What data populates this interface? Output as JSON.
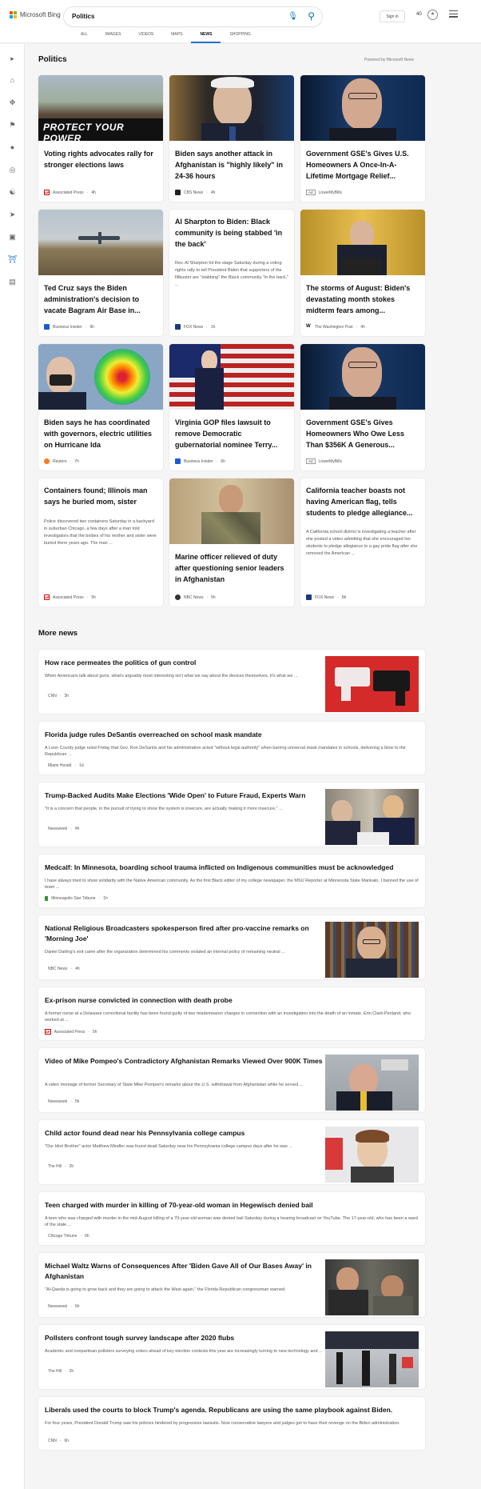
{
  "header": {
    "brand": "Microsoft Bing",
    "query": "Politics",
    "sign_in": "Sign in",
    "rewards": "40"
  },
  "tabs": [
    "ALL",
    "IMAGES",
    "VIDEOS",
    "MAPS",
    "NEWS",
    "SHOPPING"
  ],
  "section": {
    "title": "Politics",
    "powered": "Powered by Microsoft News"
  },
  "cards": [
    {
      "title": "Voting rights advocates rally for stronger elections laws",
      "source": "Associated Press",
      "age": "4h",
      "image_text": "PROTECT YOUR POWER"
    },
    {
      "title": "Biden says another attack in Afghanistan is \"highly likely\" in 24-36 hours",
      "source": "CBS News",
      "age": "4h"
    },
    {
      "title": "Government GSE's Gives U.S. Homeowners A Once-In-A-Lifetime Mortgage Relief...",
      "ad": "Ad",
      "source": "LowerMyBills"
    },
    {
      "title": "Ted Cruz says the Biden administration's decision to vacate Bagram Air Base in...",
      "source": "Business Insider",
      "age": "9h"
    },
    {
      "title": "Al Sharpton to Biden: Black community is being stabbed 'in the back'",
      "snippet": "Rev. Al Sharpton hit the stage Saturday during a voting rights rally to tell President Biden that supporters of the filibuster are \"stabbing\" the Black community \"in the back.\" ...",
      "source": "FOX News",
      "age": "1h"
    },
    {
      "title": "The storms of August: Biden's devastating month stokes midterm fears among...",
      "source": "The Washington Post",
      "age": "4h"
    },
    {
      "title": "Biden says he has coordinated with governors, electric utilities on Hurricane Ida",
      "source": "Reuters",
      "age": "7h"
    },
    {
      "title": "Virginia GOP files lawsuit to remove Democratic gubernatorial nominee Terry...",
      "source": "Business Insider",
      "age": "6h"
    },
    {
      "title": "Government GSE's Gives Homeowners Who Owe Less Than $356K A Generous...",
      "ad": "Ad",
      "source": "LowerMyBills"
    },
    {
      "title": "Containers found; Illinois man says he buried mom, sister",
      "snippet": "Police discovered two containers Saturday in a backyard in suburban Chicago, a few days after a man told investigators that the bodies of his mother and sister were buried there years ago. The man ...",
      "source": "Associated Press",
      "age": "5h"
    },
    {
      "title": "Marine officer relieved of duty after questioning senior leaders in Afghanistan",
      "source": "NBC News",
      "age": "5h"
    },
    {
      "title": "California teacher boasts not having American flag, tells students to pledge allegiance...",
      "snippet": "A California school district is investigating a teacher after she posted a video admitting that she encouraged her students to pledge allegiance to a gay pride flag after she removed the American ...",
      "source": "FOX News",
      "age": "8h"
    }
  ],
  "more_news_title": "More news",
  "more_news": [
    {
      "title": "How race permeates the politics of gun control",
      "snippet": "When Americans talk about guns, what's arguably most interesting isn't what we say about the devices themselves. It's what we ...",
      "source": "CNN",
      "age": "3h"
    },
    {
      "title": "Florida judge rules DeSantis overreached on school mask mandate",
      "snippet": "A Leon County judge ruled Friday that Gov. Ron DeSantis and his administration acted \"without legal authority\" when barring universal mask mandates in schools, delivering a blow to the Republican ...",
      "source": "Miami Herald",
      "age": "1d"
    },
    {
      "title": "Trump-Backed Audits Make Elections 'Wide Open' to Future Fraud, Experts Warn",
      "snippet": "\"It is a concern that people, in the pursuit of trying to show the system is insecure, are actually making it more insecure,\" ...",
      "source": "Newsweek",
      "age": "4h"
    },
    {
      "title": "Medcalf: In Minnesota, boarding school trauma inflicted on Indigenous communities must be acknowledged",
      "snippet": "I have always tried to show solidarity with the Native American community. As the first Black editor of my college newspaper, the MSU Reporter at Minnesota State Mankato, I banned the use of team ...",
      "source": "Minneapolis Star Tribune",
      "age": "1h"
    },
    {
      "title": "National Religious Broadcasters spokesperson fired after pro-vaccine remarks on 'Morning Joe'",
      "snippet": "Daniel Darling's exit came after the organization determined his comments violated an internal policy of remaining neutral ...",
      "source": "NBC News",
      "age": "4h"
    },
    {
      "title": "Ex-prison nurse convicted in connection with death probe",
      "snippet": "A former nurse at a Delaware correctional facility has been found guilty of two misdemeanor charges in connection with an investigation into the death of an inmate. Erin Clark-Penland, who worked at ...",
      "source": "Associated Press",
      "age": "5h"
    },
    {
      "title": "Video of Mike Pompeo's Contradictory Afghanistan Remarks Viewed Over 900K Times",
      "snippet": "A video montage of former Secretary of State Mike Pompeo's remarks about the U.S. withdrawal from Afghanistan while he served ...",
      "source": "Newsweek",
      "age": "5h"
    },
    {
      "title": "Child actor found dead near his Pennsylvania college campus",
      "snippet": "\"Our Idiot Brother\" actor Matthew Mindler was found dead Saturday near his Pennsylvania college campus days after he was ...",
      "source": "The Hill",
      "age": "2h"
    },
    {
      "title": "Teen charged with murder in killing of 70-year-old woman in Hegewisch denied bail",
      "snippet": "A teen who was charged with murder in the mid-August killing of a 70-year-old woman was denied bail Saturday during a hearing broadcast on YouTube. The 17-year-old, who has been a ward of the state ...",
      "source": "Chicago Tribune",
      "age": "6h"
    },
    {
      "title": "Michael Waltz Warns of Consequences After 'Biden Gave All of Our Bases Away' in Afghanistan",
      "snippet": "\"Al-Qaeda is going to grow back and they are going to attack the West again,\" the Florida Republican congressman warned.",
      "source": "Newsweek",
      "age": "6h"
    },
    {
      "title": "Pollsters confront tough survey landscape after 2020 flubs",
      "snippet": "Academic and nonpartisan pollsters surveying voters ahead of key election contests this year are increasingly turning to new technology and ...",
      "source": "The Hill",
      "age": "2h"
    },
    {
      "title": "Liberals used the courts to block Trump's agenda. Republicans are using the same playbook against Biden.",
      "snippet": "For four years, President Donald Trump saw his policies hindered by progressive lawsuits. Now conservative lawyers and judges get to have their revenge on the Biden administration.",
      "source": "CNN",
      "age": "6h"
    }
  ]
}
